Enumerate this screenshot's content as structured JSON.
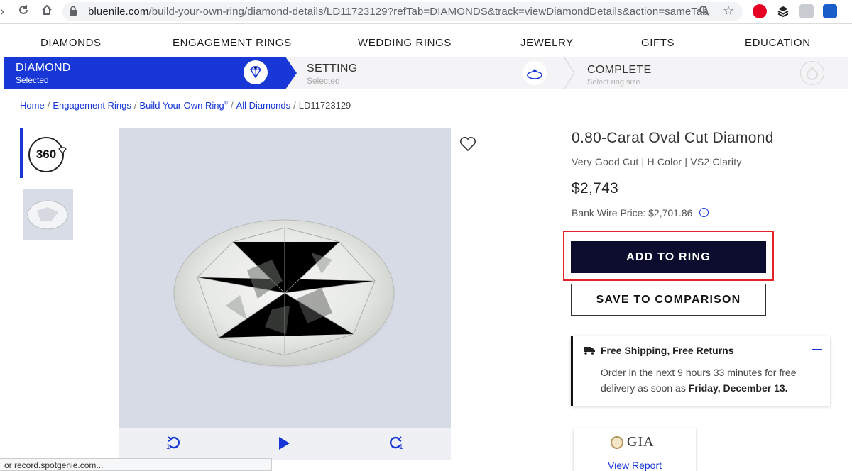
{
  "browser": {
    "url_host": "bluenile.com",
    "url_path": "/build-your-own-ring/diamond-details/LD11723129?refTab=DIAMONDS&track=viewDiamondDetails&action=sameTab",
    "status_text": "or record.spotgenie.com..."
  },
  "nav": {
    "items": [
      "DIAMONDS",
      "ENGAGEMENT RINGS",
      "WEDDING RINGS",
      "JEWELRY",
      "GIFTS",
      "EDUCATION"
    ]
  },
  "steps": [
    {
      "title": "DIAMOND",
      "sub": "Selected",
      "icon": "diamond-icon"
    },
    {
      "title": "SETTING",
      "sub": "Selected",
      "icon": "ring-setting-icon"
    },
    {
      "title": "COMPLETE",
      "sub": "Select ring size",
      "icon": "ring-icon"
    }
  ],
  "breadcrumb": {
    "items": [
      "Home",
      "Engagement Rings",
      "Build Your Own Ring",
      "All Diamonds"
    ],
    "current": "LD11723129",
    "reg_mark": "®"
  },
  "thumbs": {
    "view360": "360"
  },
  "product": {
    "title": "0.80-Carat Oval Cut Diamond",
    "subtitle": "Very Good Cut | H Color | VS2 Clarity",
    "price": "$2,743",
    "wire_price": "Bank Wire Price: $2,701.86",
    "add_label": "ADD TO RING",
    "save_label": "SAVE TO COMPARISON"
  },
  "shipping": {
    "heading": "Free Shipping, Free Returns",
    "body_prefix": "Order in the next 9 hours 33 minutes for free delivery as soon as ",
    "body_date": "Friday, December 13."
  },
  "gia": {
    "logo": "GIA",
    "link": "View Report"
  },
  "viewer": {
    "rotate_left_num": "1",
    "rotate_right_num": "1"
  },
  "colors": {
    "accent": "#1737d7",
    "primary_button": "#0c0c2e",
    "highlight": "#e3222a"
  }
}
